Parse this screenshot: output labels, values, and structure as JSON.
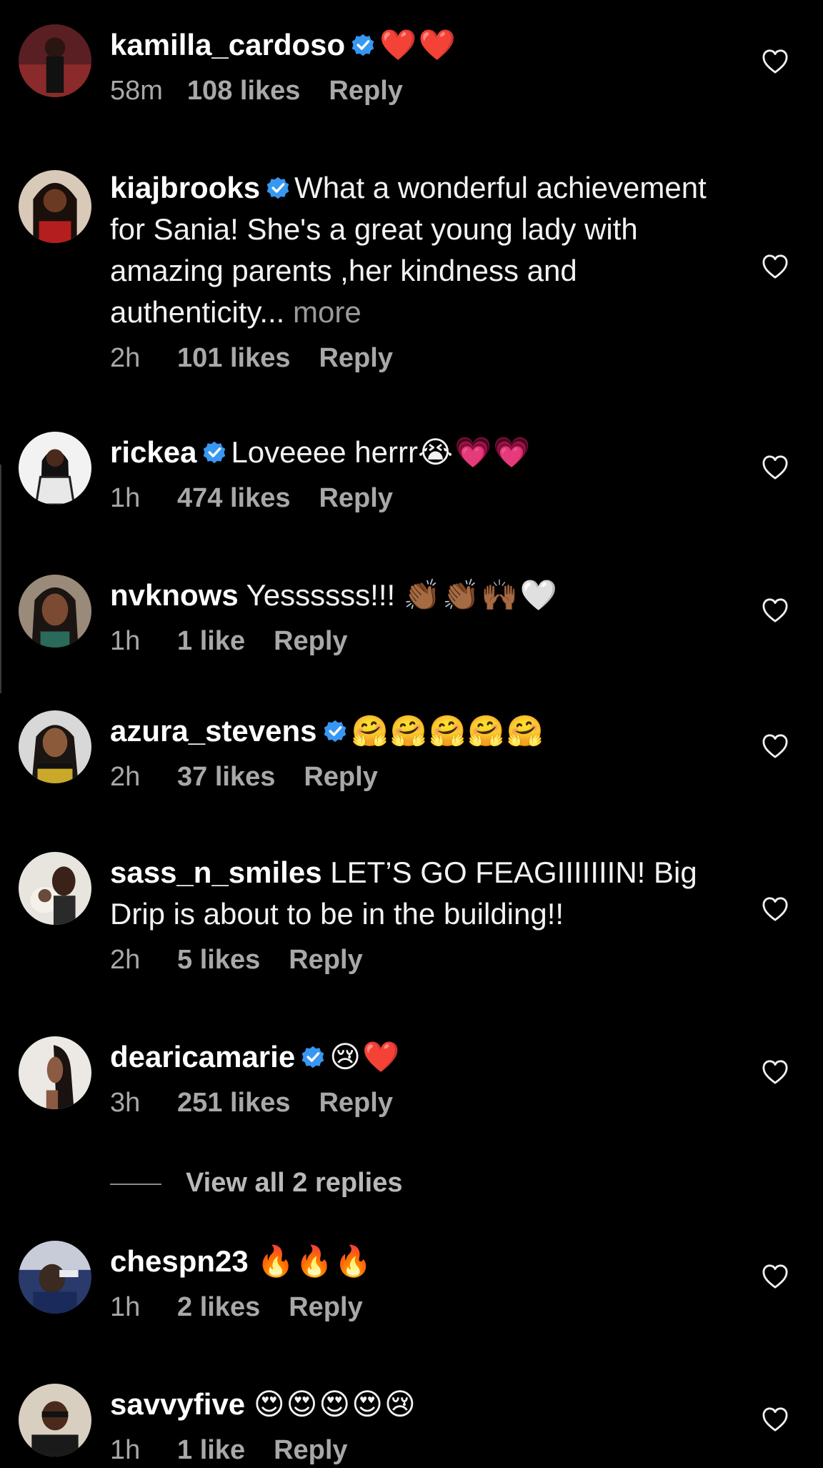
{
  "comments": [
    {
      "username": "kamilla_cardoso",
      "verified": true,
      "text": "",
      "emoji": "❤️❤️",
      "time": "58m",
      "likes": "108 likes",
      "reply": "Reply",
      "avatar_color": "#8a3b3b"
    },
    {
      "username": "kiajbrooks",
      "verified": true,
      "text": "What a wonderful achievement for Sania! She's a great young lady with amazing parents ,her kindness and authenticity...",
      "more": "more",
      "time": "2h",
      "likes": "101 likes",
      "reply": "Reply",
      "avatar_color": "#7a2a22"
    },
    {
      "username": "rickea",
      "verified": true,
      "text": "Loveeee herrr",
      "emoji": "😭💗💗",
      "time": "1h",
      "likes": "474 likes",
      "reply": "Reply",
      "avatar_color": "#d8d8d8"
    },
    {
      "username": "nvknows",
      "verified": false,
      "text": "Yessssss!!!",
      "emoji": "👏🏾👏🏾🙌🏾🤍",
      "time": "1h",
      "likes": "1 like",
      "reply": "Reply",
      "avatar_color": "#6b4a3a"
    },
    {
      "username": "azura_stevens",
      "verified": true,
      "text": "",
      "emoji": "🤗🤗🤗🤗🤗",
      "time": "2h",
      "likes": "37 likes",
      "reply": "Reply",
      "avatar_color": "#c9b46a"
    },
    {
      "username": "sass_n_smiles",
      "verified": false,
      "text": "LET’S GO FEAGIIIIIIIN! Big Drip is about to be in the building!!",
      "time": "2h",
      "likes": "5 likes",
      "reply": "Reply",
      "avatar_color": "#cfc8c0"
    },
    {
      "username": "dearicamarie",
      "verified": true,
      "text": "",
      "emoji": "😢❤️",
      "time": "3h",
      "likes": "251 likes",
      "reply": "Reply",
      "avatar_color": "#e6e2df"
    },
    {
      "username": "chespn23",
      "verified": false,
      "text": "",
      "emoji": "🔥🔥🔥",
      "time": "1h",
      "likes": "2 likes",
      "reply": "Reply",
      "avatar_color": "#3a4a8a"
    },
    {
      "username": "savvyfive",
      "verified": false,
      "text": "",
      "emoji": "😍😍😍😍😢",
      "time": "1h",
      "likes": "1 like",
      "reply": "Reply",
      "avatar_color": "#b8a88a"
    }
  ],
  "view_replies": "View all 2 replies",
  "colors": {
    "background": "#000000",
    "verified": "#3897f0",
    "secondary_text": "#a8a8a8"
  }
}
